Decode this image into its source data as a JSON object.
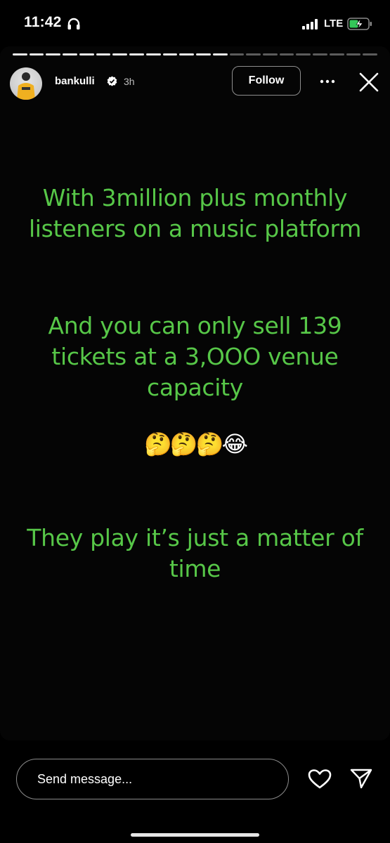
{
  "status_bar": {
    "time": "11:42",
    "network": "LTE",
    "icons": [
      "headphones-icon",
      "signal-icon",
      "battery-charging-icon"
    ]
  },
  "story": {
    "progress_segments": 22,
    "progress_done": 13,
    "username": "bankulli",
    "verified": true,
    "time_ago": "3h",
    "follow_label": "Follow",
    "text_color": "#57c748",
    "paragraph_1": "With 3million plus monthly listeners on a music platform",
    "paragraph_2": "And you can only sell 139 tickets at a 3,OOO venue capacity",
    "emojis": "🤔🤔🤔😂",
    "paragraph_3": "They play it’s just a matter of time"
  },
  "composer": {
    "placeholder": "Send message..."
  }
}
